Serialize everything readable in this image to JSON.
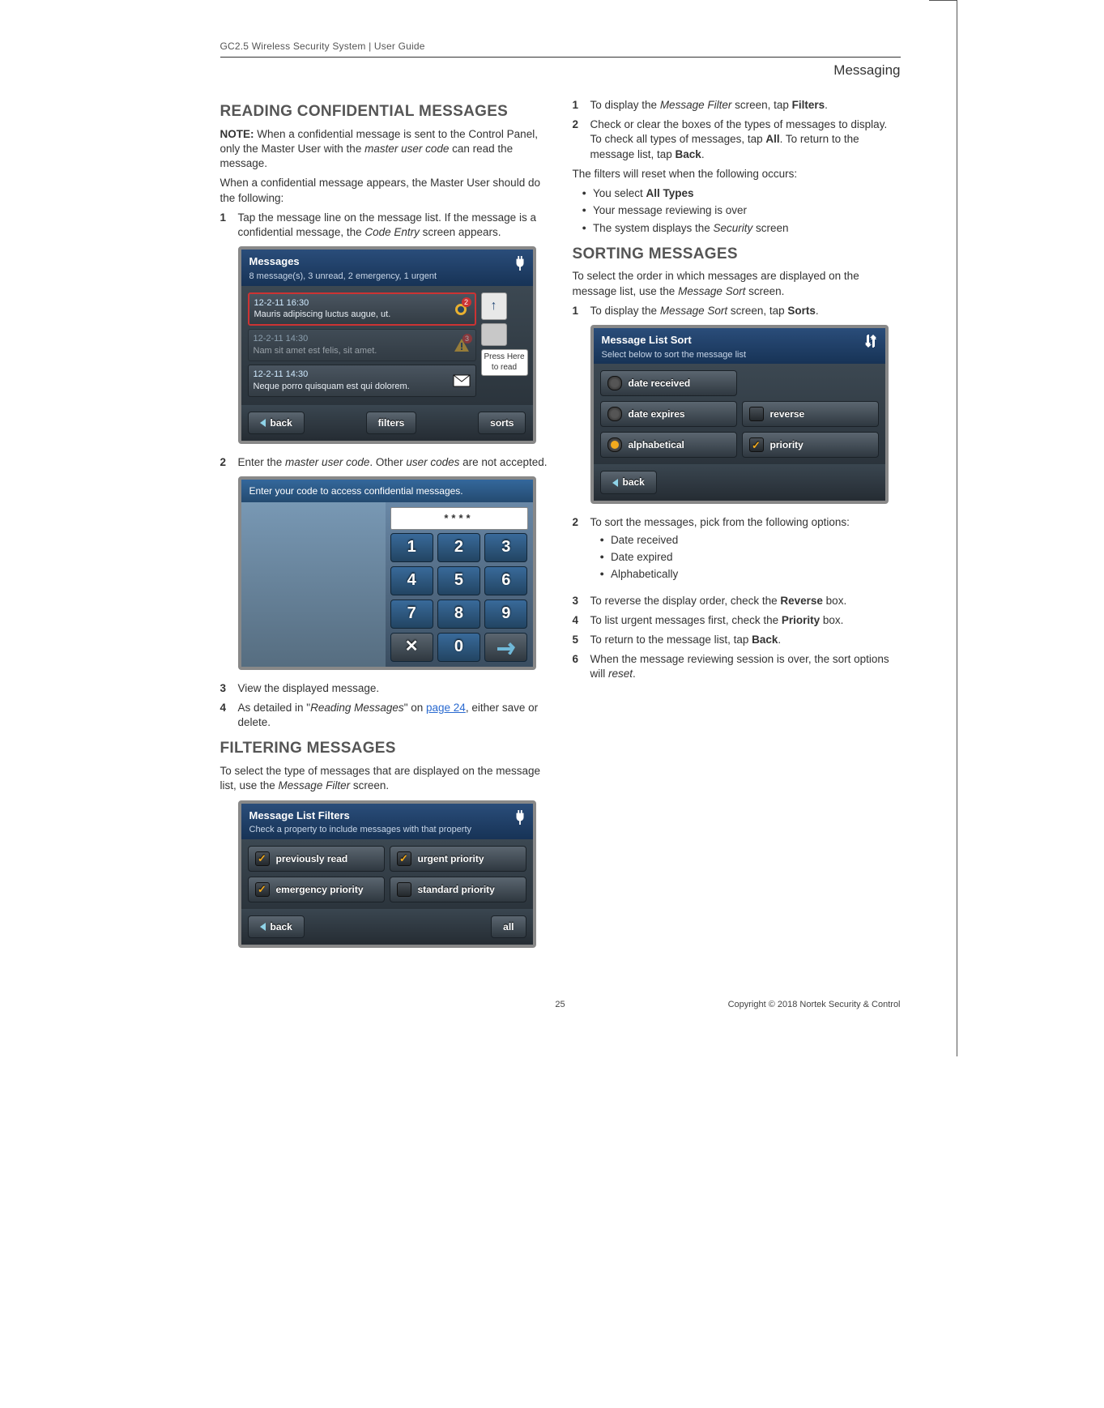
{
  "doc": {
    "header": "GC2.5 Wireless Security System | User Guide",
    "section": "Messaging",
    "page_number": "25",
    "copyright": "Copyright ©  2018 Nortek Security & Control"
  },
  "left": {
    "h_reading": "READING CONFIDENTIAL MESSAGES",
    "note_label": "NOTE:",
    "note_text": " When a confidential message is sent to the Control Panel, only the Master User with the ",
    "note_em": "master user code",
    "note_tail": " can read the message.",
    "para2": "When a confidential message appears, the Master User should do the following:",
    "step1a": "Tap the message line on the message list. If the message is a confidential message, the ",
    "step1em": "Code Entry",
    "step1b": " screen appears.",
    "step2a": "Enter the ",
    "step2em1": "master user code",
    "step2mid": ". Other ",
    "step2em2": "user codes",
    "step2b": " are not accepted.",
    "step3": "View the displayed message.",
    "step4a": "As detailed in \"",
    "step4em": "Reading Messages",
    "step4mid": "\" on ",
    "step4link": "page 24",
    "step4b": ", either save or delete.",
    "h_filter": "FILTERING MESSAGES",
    "filter_intro_a": "To select the type of messages that are displayed on the message list, use the ",
    "filter_intro_em": "Message Filter",
    "filter_intro_b": " screen."
  },
  "right": {
    "step1a": "To display the ",
    "step1em": "Message Filter",
    "step1b": " screen, tap ",
    "step1bold": "Filters",
    "step1c": ".",
    "step2a": "Check or clear the boxes of the types of messages to display. To check all types of messages, tap ",
    "step2bold1": "All",
    "step2mid": ". To return to the message list, tap ",
    "step2bold2": "Back",
    "step2c": ".",
    "reset_intro": "The filters will reset when the following occurs:",
    "reset_b1a": "You select ",
    "reset_b1bold": "All Types",
    "reset_b2": "Your message reviewing is over",
    "reset_b3a": "The system displays the ",
    "reset_b3em": "Security",
    "reset_b3b": " screen",
    "h_sort": "SORTING MESSAGES",
    "sort_intro_a": "To select the order in which messages are displayed on the message list, use the ",
    "sort_intro_em": "Message Sort",
    "sort_intro_b": " screen.",
    "sstep1a": "To display the ",
    "sstep1em": "Message Sort",
    "sstep1b": " screen, tap ",
    "sstep1bold": "Sorts",
    "sstep1c": ".",
    "sstep2": "To sort the messages, pick from the following options:",
    "sb1": "Date received",
    "sb2": "Date expired",
    "sb3": "Alphabetically",
    "sstep3a": "To reverse the display order, check the ",
    "sstep3bold": "Reverse",
    "sstep3b": " box.",
    "sstep4a": "To list urgent messages first, check the ",
    "sstep4bold": "Priority",
    "sstep4b": " box.",
    "sstep5a": "To return to the message list, tap ",
    "sstep5bold": "Back",
    "sstep5b": ".",
    "sstep6a": "When the message reviewing session is over, the sort options will ",
    "sstep6em": "reset",
    "sstep6b": "."
  },
  "screens": {
    "messages": {
      "title": "Messages",
      "sub": "8 message(s), 3 unread, 2 emergency, 1 urgent",
      "rows": [
        {
          "ts": "12-2-11 16:30",
          "text": "Mauris adipiscing luctus augue, ut.",
          "badge": "2"
        },
        {
          "ts": "12-2-11 14:30",
          "text": "Nam sit amet est felis, sit amet.",
          "badge": "3"
        },
        {
          "ts": "12-2-11 14:30",
          "text": "Neque porro quisquam est qui dolorem."
        }
      ],
      "press_here": "Press Here to read",
      "btn_back": "back",
      "btn_filters": "filters",
      "btn_sorts": "sorts"
    },
    "code": {
      "header": "Enter your code to access confidential messages.",
      "display": "****",
      "keys": [
        "1",
        "2",
        "3",
        "4",
        "5",
        "6",
        "7",
        "8",
        "9",
        "✕",
        "0",
        "✓"
      ]
    },
    "filters": {
      "title": "Message List Filters",
      "sub": "Check a property to include messages with that property",
      "opts": [
        "previously read",
        "urgent priority",
        "emergency priority",
        "standard priority"
      ],
      "btn_back": "back",
      "btn_all": "all"
    },
    "sort": {
      "title": "Message List Sort",
      "sub": "Select below to sort the message list",
      "radios": [
        "date received",
        "date expires",
        "alphabetical"
      ],
      "checks": [
        "reverse",
        "priority"
      ],
      "btn_back": "back"
    }
  }
}
